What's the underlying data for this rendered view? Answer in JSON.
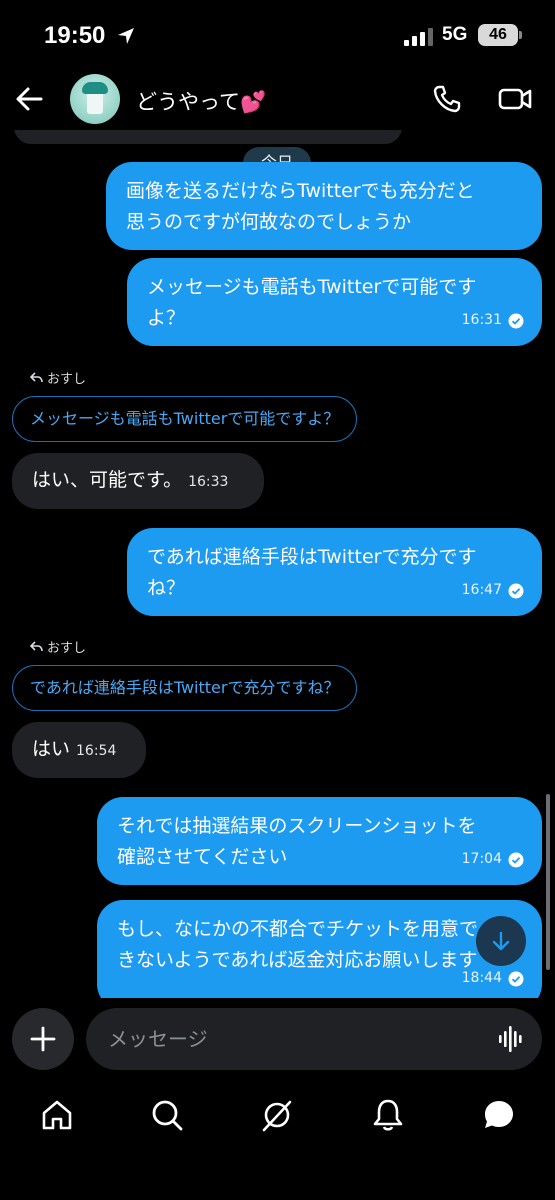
{
  "status_bar": {
    "time": "19:50",
    "network": "5G",
    "battery": "46"
  },
  "header": {
    "contact_name": "どうやって💕"
  },
  "chat": {
    "date_separator": "今日",
    "messages": [
      {
        "direction": "out",
        "text_line1": "画像を送るだけならTwitterでも充分だと",
        "text_line2": "思うのですが何故なのでしょうか"
      },
      {
        "direction": "out",
        "text_line1": "メッセージも電話もTwitterで可能です",
        "text_line2": "よ？",
        "time": "16:31"
      },
      {
        "direction": "in",
        "reply_label": "おすし",
        "quote": "メッセージも電話もTwitterで可能ですよ？",
        "text": "はい、可能です。",
        "time": "16:33"
      },
      {
        "direction": "out",
        "text_line1": "であれば連絡手段はTwitterで充分です",
        "text_line2": "ね？",
        "time": "16:47"
      },
      {
        "direction": "in",
        "reply_label": "おすし",
        "quote": "であれば連絡手段はTwitterで充分ですね？",
        "text": "はい",
        "time": "16:54"
      },
      {
        "direction": "out",
        "text_line1": "それでは抽選結果のスクリーンショットを",
        "text_line2": "確認させてください",
        "time": "17:04"
      },
      {
        "direction": "out",
        "text_line1": "もし、なにかの不都合でチケットを用意で",
        "text_line2": "きないようであれば返金対応お願いします",
        "time": "18:44"
      }
    ]
  },
  "composer": {
    "placeholder": "メッセージ"
  },
  "icons": {
    "back": "arrow-left-icon",
    "call": "phone-icon",
    "video": "video-camera-icon",
    "add": "plus-icon",
    "voice": "waveform-icon",
    "scroll_down": "arrow-down-icon",
    "tabs": [
      "home-icon",
      "search-icon",
      "grok-icon",
      "bell-icon",
      "messages-icon"
    ]
  },
  "colors": {
    "outgoing_bubble": "#1d9bf0",
    "incoming_bubble": "#202124",
    "quote_text": "#4aa8f5"
  }
}
